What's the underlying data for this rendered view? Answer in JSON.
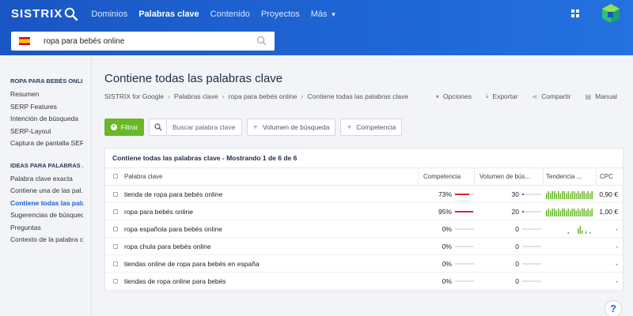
{
  "header": {
    "logo": "SISTRIX",
    "nav": [
      {
        "label": "Dominios"
      },
      {
        "label": "Palabras clave"
      },
      {
        "label": "Contenido"
      },
      {
        "label": "Proyectos"
      },
      {
        "label": "Más"
      }
    ],
    "active_nav": "Palabras clave"
  },
  "search": {
    "value": "ropa para bebés online",
    "country_flag": "spain-flag-icon"
  },
  "sidebar": {
    "section1_title": "ROPA PARA BEBÉS ONLI...",
    "section1_items": [
      "Resumen",
      "SERP Features",
      "Intención de búsqueda",
      "SERP-Layout",
      "Captura de pantalla SERP"
    ],
    "section2_title": "IDEAS PARA PALABRAS ...",
    "section2_items": [
      "Palabra clave exacta",
      "Contiene una de las pal...",
      "Contiene todas las pala...",
      "Sugerencias de búsqueda",
      "Preguntas",
      "Contexto de la palabra c..."
    ],
    "active_item": "Contiene todas las pala..."
  },
  "main": {
    "title": "Contiene todas las palabras clave",
    "breadcrumb": [
      "SISTRIX for Google",
      "Palabras clave",
      "ropa para bebés online",
      "Contiene todas las palabras clave"
    ],
    "actions": [
      "Opciones",
      "Exportar",
      "Compartir",
      "Manual"
    ],
    "filter_button": "Filtrar",
    "keyword_search_placeholder": "Buscar palabra clave",
    "chips": [
      "Volumen de búsqueda",
      "Competencia"
    ]
  },
  "table": {
    "panel_title": "Contiene todas las palabras clave - Mostrando 1 de 6 de 6",
    "columns": {
      "keyword": "Palabra clave",
      "competition": "Competencia",
      "volume": "Volumen de bús...",
      "trend": "Tendencia ...",
      "cpc": "CPC"
    },
    "rows": [
      {
        "keyword": "tienda de ropa para bebés online",
        "competition": "73%",
        "competition_value": 73,
        "volume": "30",
        "volume_fraction": 0.08,
        "trend": [
          3,
          4,
          3,
          4,
          4,
          3,
          4,
          3,
          4,
          4,
          3,
          4,
          3,
          4,
          4,
          3,
          4,
          3,
          4,
          4,
          3,
          4,
          3,
          4
        ],
        "cpc": "0,90 €"
      },
      {
        "keyword": "ropa para bebés online",
        "competition": "95%",
        "competition_value": 95,
        "volume": "20",
        "volume_fraction": 0.05,
        "trend": [
          3,
          4,
          3,
          4,
          4,
          3,
          4,
          3,
          4,
          4,
          3,
          4,
          3,
          4,
          4,
          3,
          4,
          3,
          4,
          4,
          3,
          4,
          3,
          4
        ],
        "cpc": "1,00 €"
      },
      {
        "keyword": "ropa española para bebés online",
        "competition": "0%",
        "competition_value": 0,
        "volume": "0",
        "volume_fraction": 0,
        "trend": [
          0,
          0,
          0,
          0,
          0,
          0,
          0,
          0,
          0,
          0,
          0,
          2,
          0,
          0,
          0,
          0,
          6,
          9,
          4,
          0,
          3,
          0,
          2,
          0
        ],
        "cpc": "-"
      },
      {
        "keyword": "ropa chula para bebés online",
        "competition": "0%",
        "competition_value": 0,
        "volume": "0",
        "volume_fraction": 0,
        "trend": [],
        "cpc": "-"
      },
      {
        "keyword": "tiendas online de ropa para bebés en españa",
        "competition": "0%",
        "competition_value": 0,
        "volume": "0",
        "volume_fraction": 0,
        "trend": [],
        "cpc": "-"
      },
      {
        "keyword": "tiendas de ropa online para bebés",
        "competition": "0%",
        "competition_value": 0,
        "volume": "0",
        "volume_fraction": 0,
        "trend": [],
        "cpc": "-"
      }
    ]
  },
  "help": "?",
  "colors": {
    "header": "#1f66d6",
    "filter_button": "#6ab82a",
    "competition_bar": "#d8243c",
    "trend_bar": "#6ab82a"
  }
}
